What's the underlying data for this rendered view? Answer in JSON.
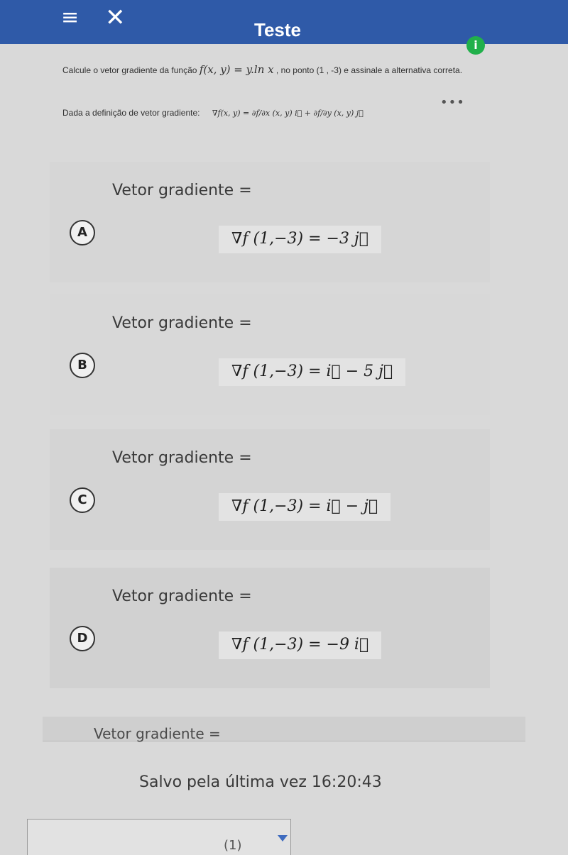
{
  "header": {
    "title": "Teste",
    "menu_icon": "≡",
    "close_icon": "✕",
    "info_icon": "i"
  },
  "question": {
    "text_before": "Calcule o vetor gradiente da função",
    "function": "f(x, y) = y.ln x",
    "text_after": ", no ponto (1 , -3) e assinale a alternativa correta."
  },
  "definition": {
    "label": "Dada a definição de vetor gradiente:",
    "formula": "∇f(x, y) = ∂f/∂x (x, y) i⃗ + ∂f/∂y (x, y) j⃗"
  },
  "more_icon": "•••",
  "options": [
    {
      "letter": "A",
      "label": "Vetor gradiente =",
      "formula": "∇f (1,−3) = −3 j⃗"
    },
    {
      "letter": "B",
      "label": "Vetor gradiente =",
      "formula": "∇f (1,−3) = i⃗ − 5 j⃗"
    },
    {
      "letter": "C",
      "label": "Vetor gradiente =",
      "formula": "∇f (1,−3) = i⃗ − j⃗"
    },
    {
      "letter": "D",
      "label": "Vetor gradiente =",
      "formula": "∇f (1,−3) = −9 i⃗"
    }
  ],
  "partial_option": {
    "label": "Vetor gradiente ="
  },
  "status": {
    "saved_text": "Salvo pela última vez 16:20:43"
  },
  "bottom": {
    "partial_text": "(1)"
  },
  "colors": {
    "header": "#2f5aa8",
    "info": "#21b04b"
  }
}
